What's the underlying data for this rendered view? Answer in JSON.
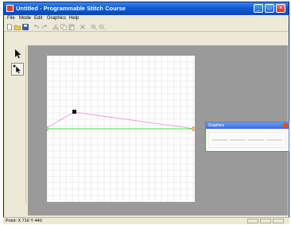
{
  "window": {
    "title": "Untitled - Programmable Stitch Course"
  },
  "titlebar_buttons": {
    "minimize": "_",
    "maximize": "□",
    "close": "×"
  },
  "menu": [
    "File",
    "Mode",
    "Edit",
    "Graphics",
    "Help"
  ],
  "toolbar": {
    "tools": [
      {
        "icon": "new-file-icon",
        "enabled": true
      },
      {
        "icon": "open-folder-icon",
        "enabled": true
      },
      {
        "icon": "save-icon",
        "enabled": true
      },
      {
        "icon": "undo-icon",
        "enabled": false
      },
      {
        "icon": "redo-icon",
        "enabled": false
      },
      {
        "icon": "cut-icon",
        "enabled": false
      },
      {
        "icon": "copy-icon",
        "enabled": false
      },
      {
        "icon": "paste-icon",
        "enabled": false
      },
      {
        "icon": "delete-icon",
        "enabled": false
      },
      {
        "icon": "zoom-in-icon",
        "enabled": false
      },
      {
        "icon": "zoom-out-icon",
        "enabled": false
      }
    ]
  },
  "palette": {
    "tools": [
      "pointer-arrow-icon",
      "node-arrow-icon"
    ]
  },
  "floating_panel": {
    "title": "Graphics"
  },
  "status": {
    "text": "Point: X 716 Y 440"
  },
  "colors": {
    "title_bar": "#0a58d6",
    "guide_line": "#40e040",
    "stitch_path": "#f08ad8",
    "workspace": "#9a9a9a",
    "grid": "#e0e0e0"
  }
}
